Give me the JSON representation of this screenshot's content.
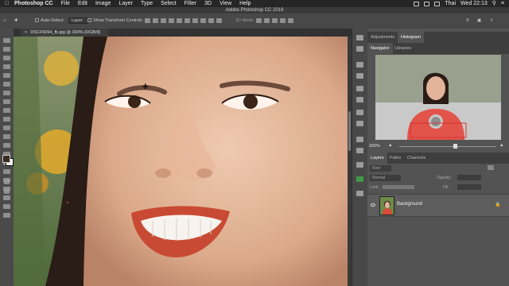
{
  "menubar": {
    "app": "Photoshop CC",
    "menus": [
      "File",
      "Edit",
      "Image",
      "Layer",
      "Type",
      "Select",
      "Filter",
      "3D",
      "View",
      "Help"
    ],
    "user": "Thai",
    "clock": "Wed 22:13"
  },
  "window": {
    "title": "Adobe Photoshop CC 2019"
  },
  "options": {
    "auto_select": "Auto-Select:",
    "layer_dropdown": "Layer",
    "show_transform": "Show Transform Controls",
    "mode_3d": "3D Mode:"
  },
  "document": {
    "tab_title": "DSCF6094_fb.jpg @ 300% (RGB/8)"
  },
  "panels": {
    "top_tabs": [
      "Adjustments",
      "Histogram"
    ],
    "nav_tabs": [
      "Navigator",
      "Libraries"
    ],
    "zoom": "300%",
    "layers_tabs": [
      "Layers",
      "Paths",
      "Channels"
    ],
    "kind_label": "Kind",
    "blend_mode": "Normal",
    "opacity_label": "Opacity:",
    "lock_label": "Lock:",
    "fill_label": "Fill:",
    "layer_name": "Background"
  },
  "colors": {
    "accent": "#2f7fd8",
    "panel": "#535353",
    "dark": "#262626"
  }
}
